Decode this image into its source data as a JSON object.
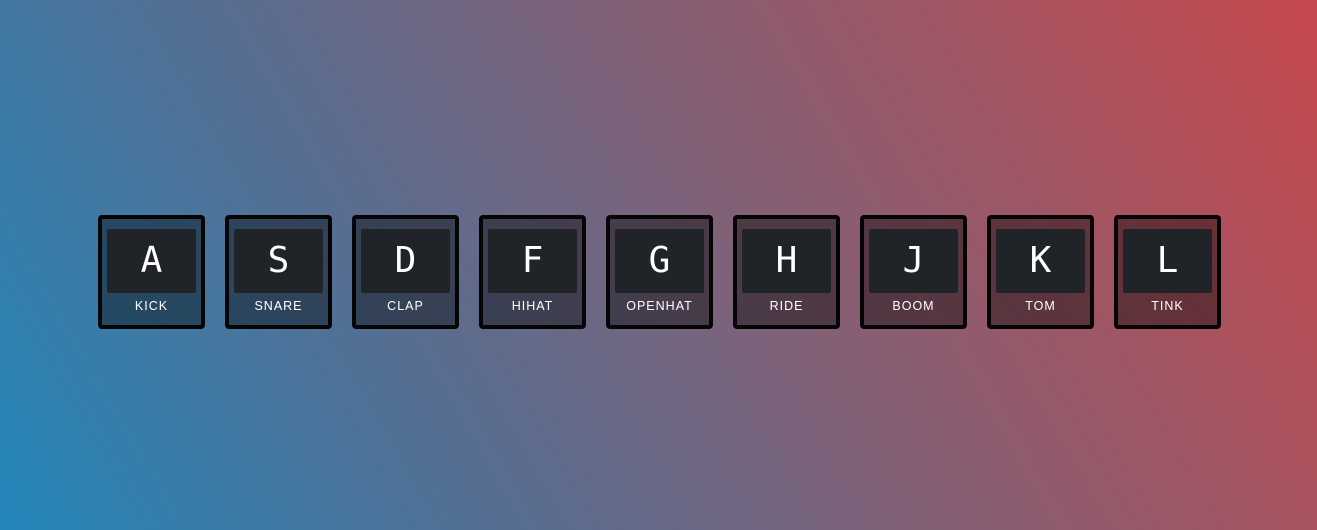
{
  "drumkit": {
    "keys": [
      {
        "letter": "A",
        "sound": "KICK"
      },
      {
        "letter": "S",
        "sound": "SNARE"
      },
      {
        "letter": "D",
        "sound": "CLAP"
      },
      {
        "letter": "F",
        "sound": "HIHAT"
      },
      {
        "letter": "G",
        "sound": "OPENHAT"
      },
      {
        "letter": "H",
        "sound": "RIDE"
      },
      {
        "letter": "J",
        "sound": "BOOM"
      },
      {
        "letter": "K",
        "sound": "TOM"
      },
      {
        "letter": "L",
        "sound": "TINK"
      }
    ]
  },
  "colors": {
    "gradient_bottom_left": "#2386ba",
    "gradient_top_right": "#c6474d",
    "key_border": "#050505",
    "key_cap": "#202328",
    "text": "#ffffff"
  }
}
